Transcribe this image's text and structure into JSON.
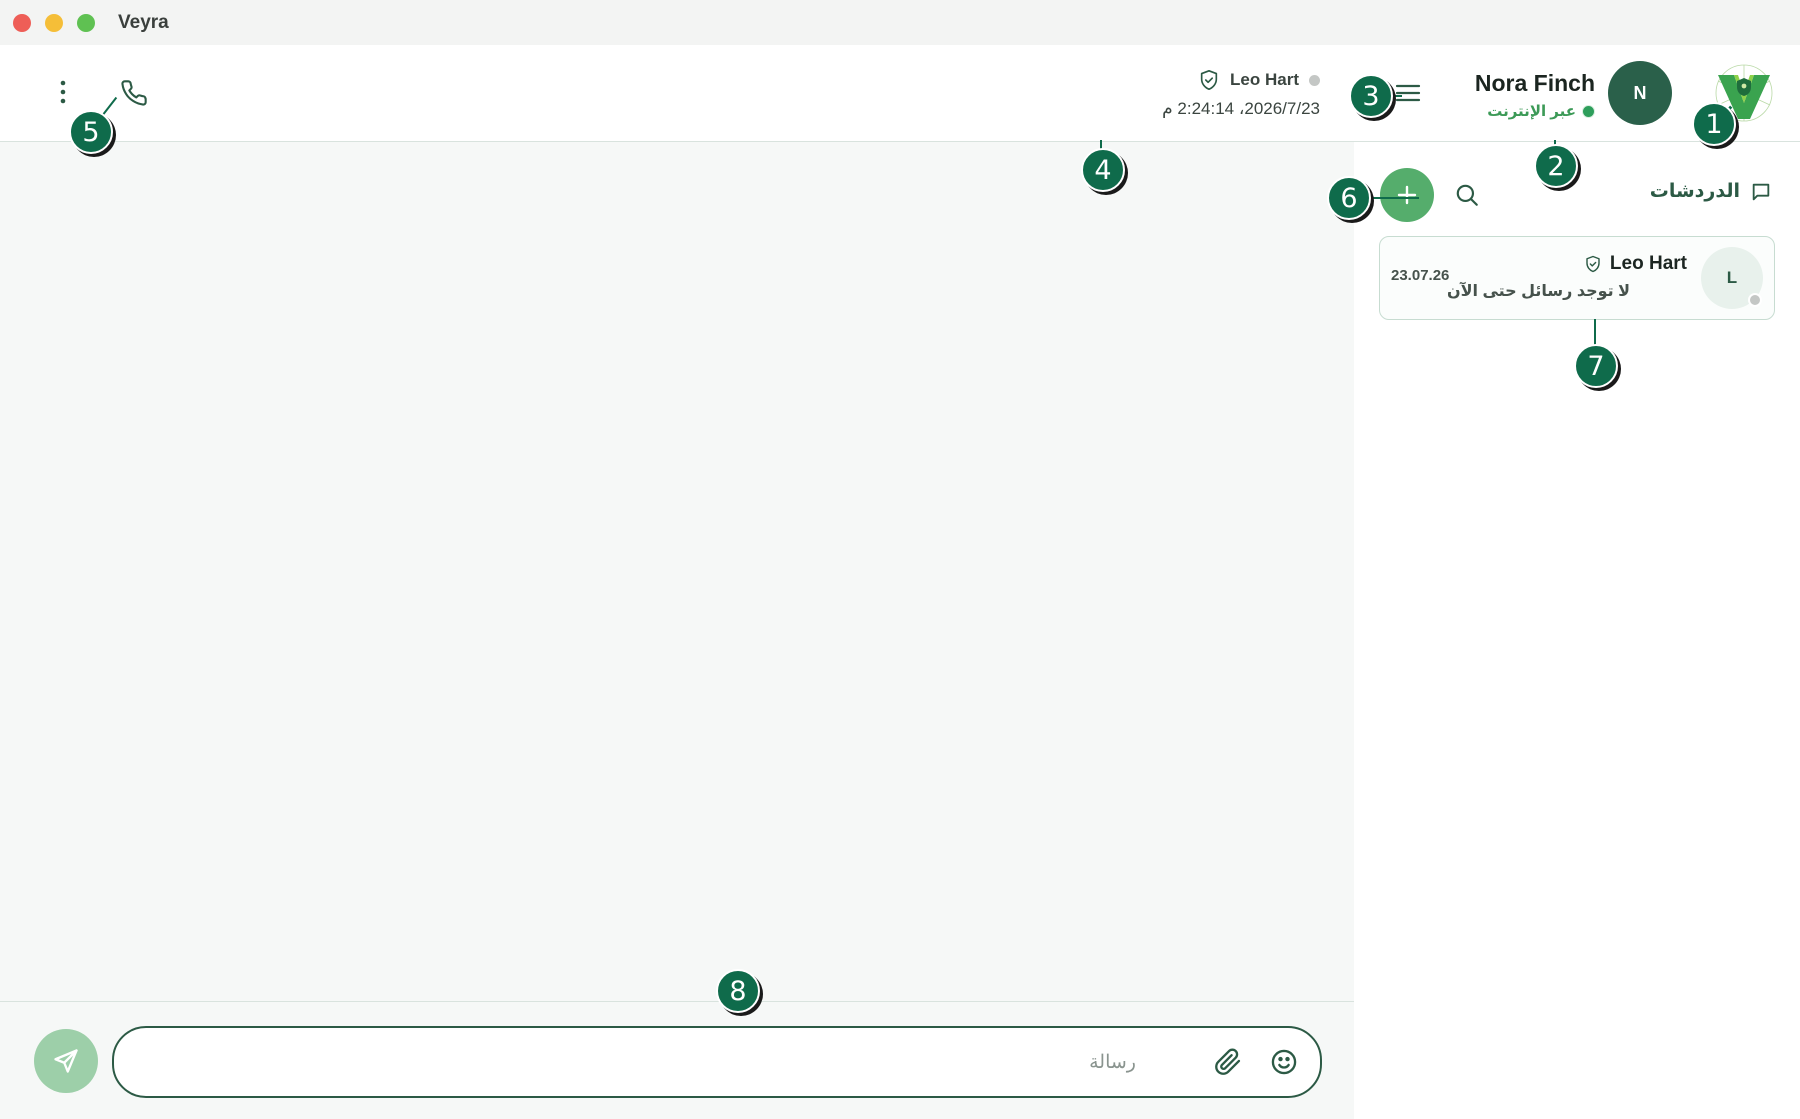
{
  "window": {
    "title": "Veyra"
  },
  "header": {
    "contact_name": "Leo Hart",
    "contact_timestamp": "2026/7/23، 2:24:14 م",
    "user_name": "Nora Finch",
    "user_status": "عبر الإنترنت",
    "user_initial": "N"
  },
  "sidebar": {
    "title": "الدردشات",
    "chats": [
      {
        "name": "Leo Hart",
        "initial": "L",
        "preview": "لا توجد رسائل حتى الآن",
        "date": "23.07.26"
      }
    ]
  },
  "composer": {
    "placeholder": "رسالة"
  },
  "callouts": [
    "1",
    "2",
    "3",
    "4",
    "5",
    "6",
    "7",
    "8"
  ],
  "colors": {
    "brand": "#2c5a45",
    "accent": "#55ad6c",
    "online": "#2e9e5b",
    "callout": "#0f6b4b"
  }
}
